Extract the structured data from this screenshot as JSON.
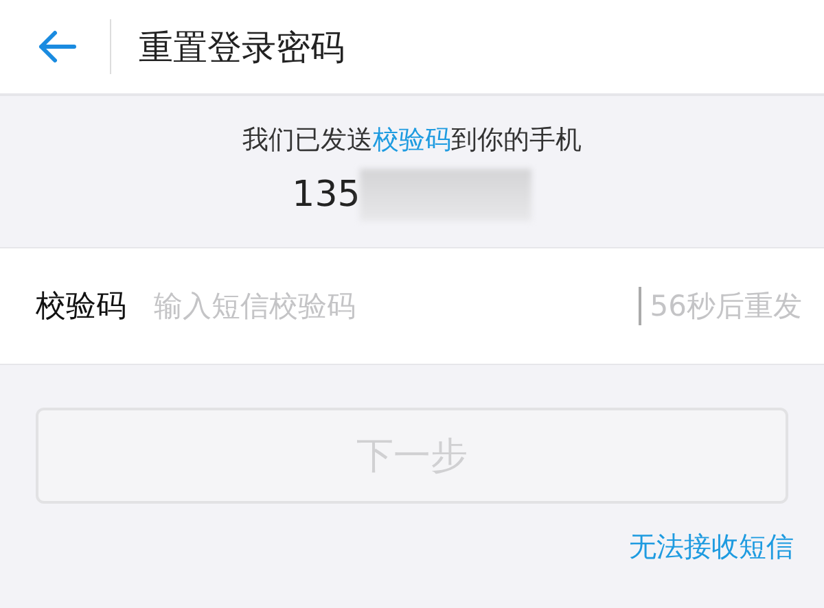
{
  "header": {
    "title": "重置登录密码"
  },
  "notice": {
    "before": "我们已发送",
    "highlight": "校验码",
    "after": "到你的手机",
    "phone": "135"
  },
  "code_field": {
    "label": "校验码",
    "placeholder": "输入短信校验码",
    "resend": "56秒后重发"
  },
  "next_button": {
    "label": "下一步",
    "disabled": true
  },
  "help_link": "无法接收短信"
}
